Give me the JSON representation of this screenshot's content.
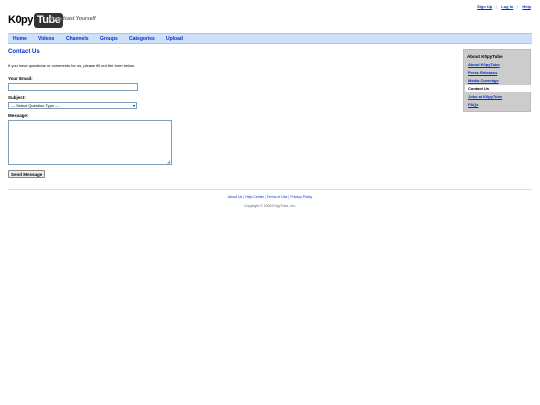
{
  "header": {
    "top_links": [
      "Sign Up",
      "Log In",
      "Help"
    ],
    "logo_prefix": "K0py",
    "logo_tube": "Tube",
    "tagline": "Broadcast Yourself"
  },
  "nav": [
    "Home",
    "Videos",
    "Channels",
    "Groups",
    "Categories",
    "Upload"
  ],
  "main": {
    "title": "Contact Us",
    "intro": "If you have questions or comments for us, please fill out the form below.",
    "email_label": "Your Email:",
    "email_value": "",
    "subject_label": "Subject:",
    "subject_selected": "--- Select Question Type ---",
    "message_label": "Message:",
    "message_value": "",
    "send_label": "Send Message"
  },
  "sidebar": {
    "title": "About K0pyTube",
    "items": [
      "About K0pyTube",
      "Press Releases",
      "Media Coverage",
      "Contact Us",
      "Jobs at K0pyTube",
      "FAQs"
    ],
    "current_index": 3
  },
  "footer": {
    "links": [
      "About Us",
      "Help Center",
      "Terms of Use",
      "Privacy Policy"
    ],
    "copyright": "Copyright © 2008 K0pyTube, Inc."
  }
}
